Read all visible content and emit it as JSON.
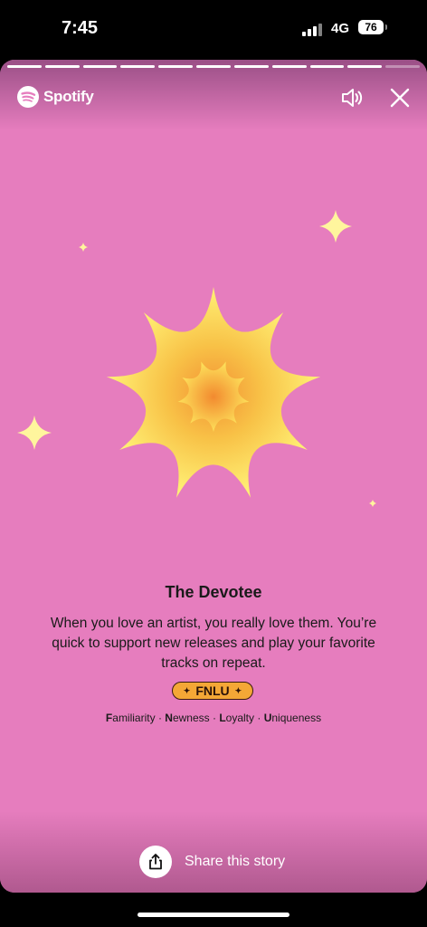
{
  "status_bar": {
    "time": "7:45",
    "network": "4G",
    "battery": "76"
  },
  "story": {
    "progress": {
      "segments": 11,
      "completed": 10,
      "current_fill": 0.0
    },
    "brand": "Spotify",
    "title": "The Devotee",
    "description": "When you love an artist, you really love them. You’re quick to support new releases and play your favorite tracks on repeat.",
    "badge": {
      "code": "FNLU",
      "star": "✦"
    },
    "legend": [
      {
        "initial": "F",
        "rest": "amiliarity"
      },
      {
        "initial": "N",
        "rest": "ewness"
      },
      {
        "initial": "L",
        "rest": "oyalty"
      },
      {
        "initial": "U",
        "rest": "niqueness"
      }
    ],
    "legend_separator": " · ",
    "share_label": "Share this story"
  },
  "colors": {
    "background": "#e67dbe",
    "star_outer": "#fff176",
    "star_inner": "#f39233",
    "sparkle": "#fff59d",
    "badge": "#f4a736"
  },
  "icons": {
    "brand": "spotify-logo",
    "sound": "speaker-icon",
    "close": "close-icon",
    "share": "share-icon"
  }
}
